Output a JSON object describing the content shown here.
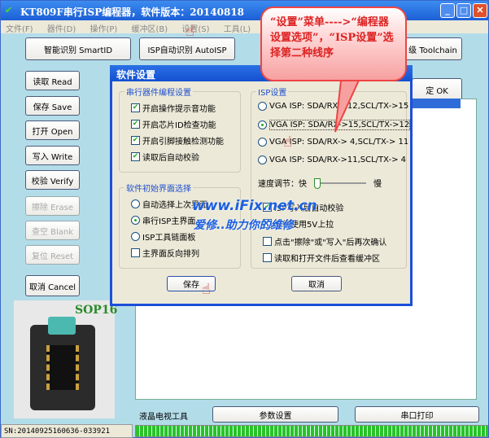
{
  "window": {
    "title": "KT809F串行ISP编程器，软件版本：20140818"
  },
  "menu": [
    "文件(F)",
    "器件(D)",
    "操作(P)",
    "缓冲区(B)",
    "设置(S)",
    "工具(L)",
    "帮助"
  ],
  "top_buttons": {
    "smartid": "智能识别 SmartID",
    "autoisp": "ISP自动识别 AutoISP",
    "toolchain": "级 Toolchain",
    "ok": "定 OK"
  },
  "left_buttons": [
    {
      "label": "读取 Read",
      "enabled": true
    },
    {
      "label": "保存 Save",
      "enabled": true
    },
    {
      "label": "打开 Open",
      "enabled": true
    },
    {
      "label": "写入 Write",
      "enabled": true
    },
    {
      "label": "校验 Verify",
      "enabled": true
    },
    {
      "label": "擦除 Erase",
      "enabled": false
    },
    {
      "label": "查空 Blank",
      "enabled": false
    },
    {
      "label": "复位 Reset",
      "enabled": false
    },
    {
      "label": "取消 Cancel",
      "enabled": true
    }
  ],
  "chip_label": "SOP16",
  "bottom": {
    "lcd_tools": "液晶电视工具",
    "params": "参数设置",
    "serial_print": "串口打印",
    "sn": "SN:20140925160636-033921",
    "progress": 100
  },
  "dialog": {
    "title": "软件设置",
    "group1": {
      "legend": "串行器件编程设置",
      "items": [
        {
          "label": "开启操作提示音功能",
          "checked": true
        },
        {
          "label": "开启芯片ID检查功能",
          "checked": true
        },
        {
          "label": "开启引脚接触检测功能",
          "checked": true
        },
        {
          "label": "读取后自动校验",
          "checked": true
        }
      ]
    },
    "group2": {
      "legend": "软件初始界面选择",
      "radios": [
        {
          "label": "自动选择上次界面",
          "selected": false
        },
        {
          "label": "串行ISP主界面",
          "selected": true
        },
        {
          "label": "ISP工具链面板",
          "selected": false
        }
      ],
      "checkbox": {
        "label": "主界面反向排列",
        "checked": false
      }
    },
    "isp": {
      "legend": "ISP设置",
      "radios": [
        {
          "label": "VGA ISP: SDA/RX->12,SCL/TX->15",
          "selected": false
        },
        {
          "label": "VGA ISP: SDA/RX->15,SCL/TX->12",
          "selected": true
        },
        {
          "label": "VGA ISP: SDA/RX-> 4,SCL/TX-> 11",
          "selected": false
        },
        {
          "label": "VGA ISP: SDA/RX->11,SCL/TX-> 4",
          "selected": false
        }
      ],
      "speed_label": "速度调节：快",
      "speed_slow": "慢",
      "speed_value": 0,
      "checks": [
        {
          "label": "ISP写入后自动校验",
          "checked": true
        },
        {
          "label": "总线使用5V上拉",
          "checked": true
        },
        {
          "label": "点击\"擦除\"或\"写入\"后再次确认",
          "checked": false
        },
        {
          "label": "读取和打开文件后查看缓冲区",
          "checked": false
        }
      ]
    },
    "save": "保存",
    "cancel": "取消"
  },
  "callout": "“设置”菜单---->“编程器设置选项”，“ISP设置”选择第二种线序",
  "watermark": {
    "line1": "www.iFix.net.cn",
    "line2": "爱修..助力你的维修"
  }
}
